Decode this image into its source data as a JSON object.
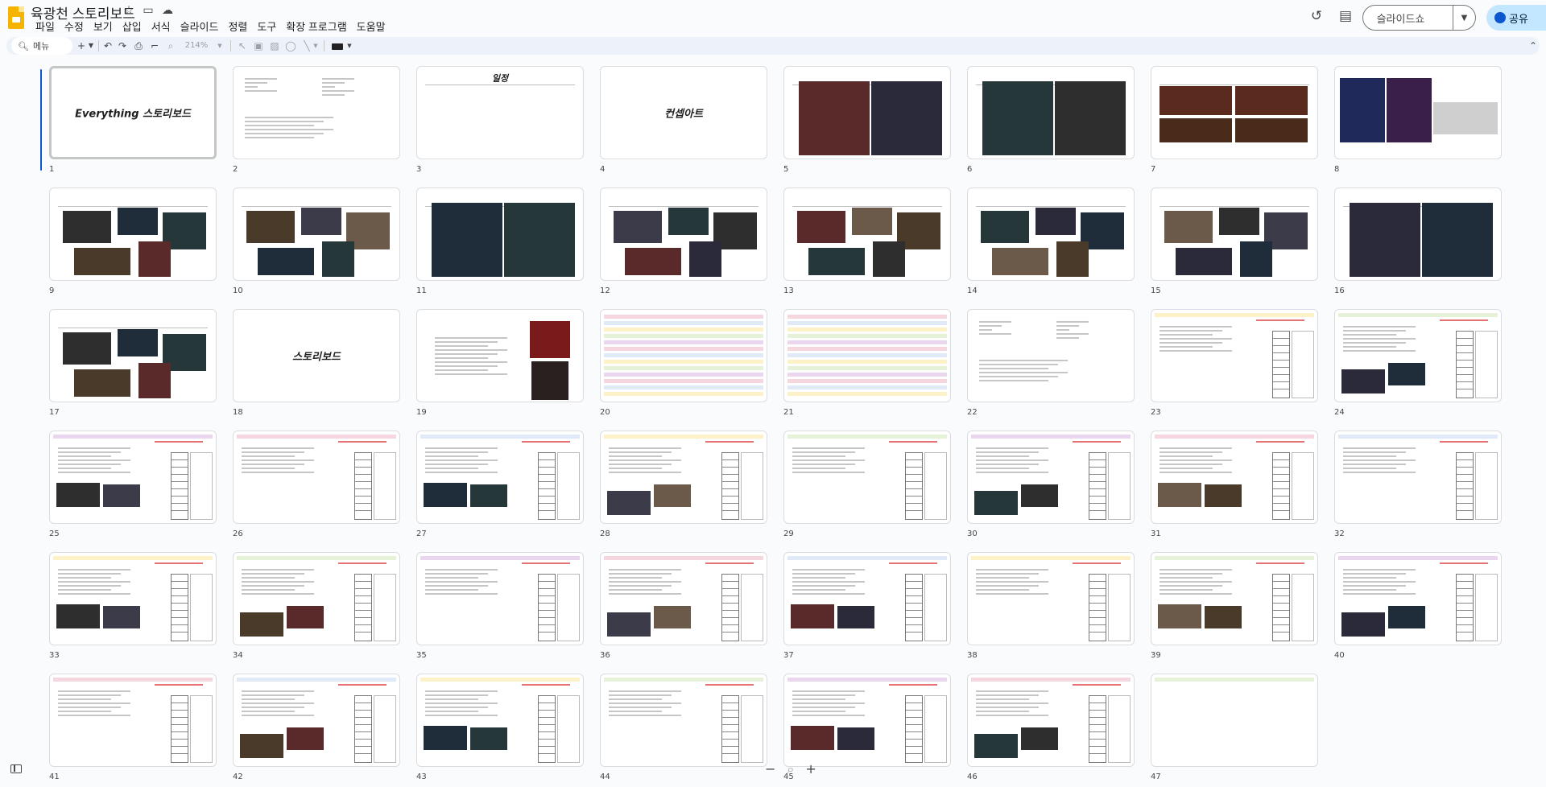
{
  "title": "육광천 스토리보드",
  "menu": [
    "파일",
    "수정",
    "보기",
    "삽입",
    "서식",
    "슬라이드",
    "정렬",
    "도구",
    "확장 프로그램",
    "도움말"
  ],
  "toolbar": {
    "search_label": "메뉴",
    "zoom": "214%"
  },
  "actions": {
    "slideshow": "슬라이드쇼",
    "share": "공유"
  },
  "slides": [
    {
      "n": "1",
      "title": "Everything 스토리보드",
      "kind": "title"
    },
    {
      "n": "2",
      "kind": "text"
    },
    {
      "n": "3",
      "title": "일정",
      "kind": "heading"
    },
    {
      "n": "4",
      "title": "컨셉아트",
      "kind": "title"
    },
    {
      "n": "5",
      "kind": "images2"
    },
    {
      "n": "6",
      "kind": "images2"
    },
    {
      "n": "7",
      "kind": "images4"
    },
    {
      "n": "8",
      "kind": "images3"
    },
    {
      "n": "9",
      "kind": "collage"
    },
    {
      "n": "10",
      "kind": "collage"
    },
    {
      "n": "11",
      "kind": "images2"
    },
    {
      "n": "12",
      "kind": "collage"
    },
    {
      "n": "13",
      "kind": "collage"
    },
    {
      "n": "14",
      "kind": "collage"
    },
    {
      "n": "15",
      "kind": "collage"
    },
    {
      "n": "16",
      "kind": "images2"
    },
    {
      "n": "17",
      "kind": "collage"
    },
    {
      "n": "18",
      "title": "스토리보드",
      "kind": "title"
    },
    {
      "n": "19",
      "kind": "textimg"
    },
    {
      "n": "20",
      "kind": "sheet"
    },
    {
      "n": "21",
      "kind": "sheet"
    },
    {
      "n": "22",
      "kind": "text"
    },
    {
      "n": "23",
      "kind": "board"
    },
    {
      "n": "24",
      "kind": "board"
    },
    {
      "n": "25",
      "kind": "board"
    },
    {
      "n": "26",
      "kind": "board"
    },
    {
      "n": "27",
      "kind": "board"
    },
    {
      "n": "28",
      "kind": "board"
    },
    {
      "n": "29",
      "kind": "board"
    },
    {
      "n": "30",
      "kind": "board"
    },
    {
      "n": "31",
      "kind": "board"
    },
    {
      "n": "32",
      "kind": "board"
    },
    {
      "n": "33",
      "kind": "board"
    },
    {
      "n": "34",
      "kind": "board"
    },
    {
      "n": "35",
      "kind": "board"
    },
    {
      "n": "36",
      "kind": "board"
    },
    {
      "n": "37",
      "kind": "board"
    },
    {
      "n": "38",
      "kind": "board"
    },
    {
      "n": "39",
      "kind": "board"
    },
    {
      "n": "40",
      "kind": "board"
    },
    {
      "n": "41",
      "kind": "board"
    },
    {
      "n": "42",
      "kind": "board"
    },
    {
      "n": "43",
      "kind": "board"
    },
    {
      "n": "44",
      "kind": "board"
    },
    {
      "n": "45",
      "kind": "board"
    },
    {
      "n": "46",
      "kind": "board"
    },
    {
      "n": "47",
      "kind": "blank"
    }
  ],
  "colors": {
    "accent": "#0b57d0",
    "share_bg": "#c2e7ff",
    "toolbar_bg": "#edf2fa",
    "logo": "#f4b400"
  }
}
